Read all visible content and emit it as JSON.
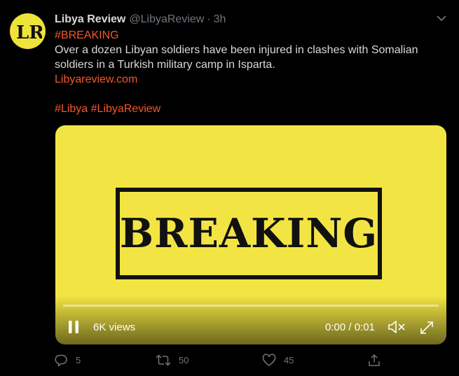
{
  "account": {
    "name": "Libya Review",
    "handle": "@LibyaReview",
    "separator": "·",
    "time": "3h",
    "avatar_text": "LR"
  },
  "tweet": {
    "hashtag_breaking": "#BREAKING",
    "text_line1": "Over a dozen Libyan soldiers have been injured in clashes with Somalian",
    "text_line2": "soldiers in a Turkish military camp in Isparta.",
    "link": "Libyareview.com",
    "hashtag_libya": "#Libya",
    "hashtag_libyareview": "#LibyaReview"
  },
  "media": {
    "banner_text": "BREAKING",
    "views": "6K views",
    "timecode": "0:00 / 0:01",
    "progress": 0.0,
    "background": "#f2e543"
  },
  "actions": {
    "replies": "5",
    "retweets": "50",
    "likes": "45"
  },
  "colors": {
    "background": "#000000",
    "text": "#d9d9d9",
    "muted": "#6e767d",
    "accent": "#f4572b",
    "brand_yellow": "#eee33b"
  },
  "icons": [
    "caret-down-icon",
    "pause-icon",
    "mute-icon",
    "expand-icon",
    "reply-icon",
    "retweet-icon",
    "like-icon",
    "share-icon"
  ]
}
